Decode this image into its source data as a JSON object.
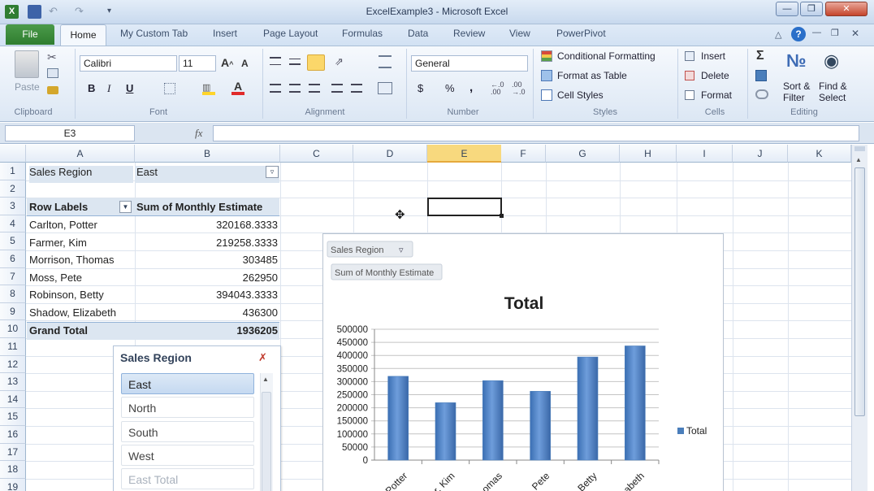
{
  "window": {
    "title": "ExcelExample3 - Microsoft Excel"
  },
  "tabs": {
    "file": "File",
    "home": "Home",
    "custom": "My Custom Tab",
    "insert": "Insert",
    "page_layout": "Page Layout",
    "formulas": "Formulas",
    "data": "Data",
    "review": "Review",
    "view": "View",
    "powerpivot": "PowerPivot"
  },
  "ribbon": {
    "clipboard": {
      "label": "Clipboard",
      "paste": "Paste"
    },
    "font": {
      "label": "Font",
      "name": "Calibri",
      "size": "11",
      "bold": "B",
      "italic": "I",
      "underline": "U"
    },
    "alignment": {
      "label": "Alignment"
    },
    "number": {
      "label": "Number",
      "format": "General",
      "dollar": "$",
      "percent": "%",
      "comma": ","
    },
    "styles": {
      "label": "Styles",
      "conditional": "Conditional Formatting",
      "format_table": "Format as Table",
      "cell_styles": "Cell Styles"
    },
    "cells": {
      "label": "Cells",
      "insert": "Insert",
      "delete": "Delete",
      "format": "Format"
    },
    "editing": {
      "label": "Editing",
      "sort1": "Sort &",
      "sort2": "Filter",
      "find1": "Find &",
      "find2": "Select"
    }
  },
  "formula_bar": {
    "name_box": "E3",
    "fx": "fx",
    "value": ""
  },
  "columns": [
    "A",
    "B",
    "C",
    "D",
    "E",
    "F",
    "G",
    "H",
    "I",
    "J",
    "K"
  ],
  "rows": [
    "1",
    "2",
    "3",
    "4",
    "5",
    "6",
    "7",
    "8",
    "9",
    "10",
    "11",
    "12",
    "13",
    "14",
    "15",
    "16",
    "17",
    "18",
    "19"
  ],
  "sheet": {
    "filter_label": "Sales Region",
    "filter_value": "East",
    "header_rows": "Row Labels",
    "header_sum": "Sum of Monthly Estimate",
    "data": [
      {
        "name": "Carlton, Potter",
        "value": "320168.3333"
      },
      {
        "name": "Farmer, Kim",
        "value": "219258.3333"
      },
      {
        "name": "Morrison, Thomas",
        "value": "303485"
      },
      {
        "name": "Moss, Pete",
        "value": "262950"
      },
      {
        "name": "Robinson, Betty",
        "value": "394043.3333"
      },
      {
        "name": "Shadow, Elizabeth",
        "value": "436300"
      }
    ],
    "grand_total_label": "Grand Total",
    "grand_total_value": "1936205"
  },
  "slicer": {
    "title": "Sales Region",
    "items": [
      "East",
      "North",
      "South",
      "West",
      "East Total"
    ],
    "selected": "East"
  },
  "chart_data": {
    "type": "bar",
    "title": "Total",
    "filter_button": "Sales Region",
    "value_button": "Sum of Monthly Estimate",
    "categories": [
      "Carlton, Potter",
      "Farmer, Kim",
      "Morrison, Thomas",
      "Moss, Pete",
      "Robinson, Betty",
      "Shadow, Elizabeth"
    ],
    "visible_tick_labels": [
      "Potter",
      "r, Kim",
      "omas",
      "Pete",
      "Betty",
      "abeth"
    ],
    "series": [
      {
        "name": "Total",
        "values": [
          320168.3333,
          219258.3333,
          303485,
          262950,
          394043.3333,
          436300
        ]
      }
    ],
    "ylim": [
      0,
      500000
    ],
    "y_ticks": [
      "0",
      "50000",
      "100000",
      "150000",
      "200000",
      "250000",
      "300000",
      "350000",
      "400000",
      "450000",
      "500000"
    ],
    "legend": "right",
    "bar_color": "#4a7ebb"
  }
}
